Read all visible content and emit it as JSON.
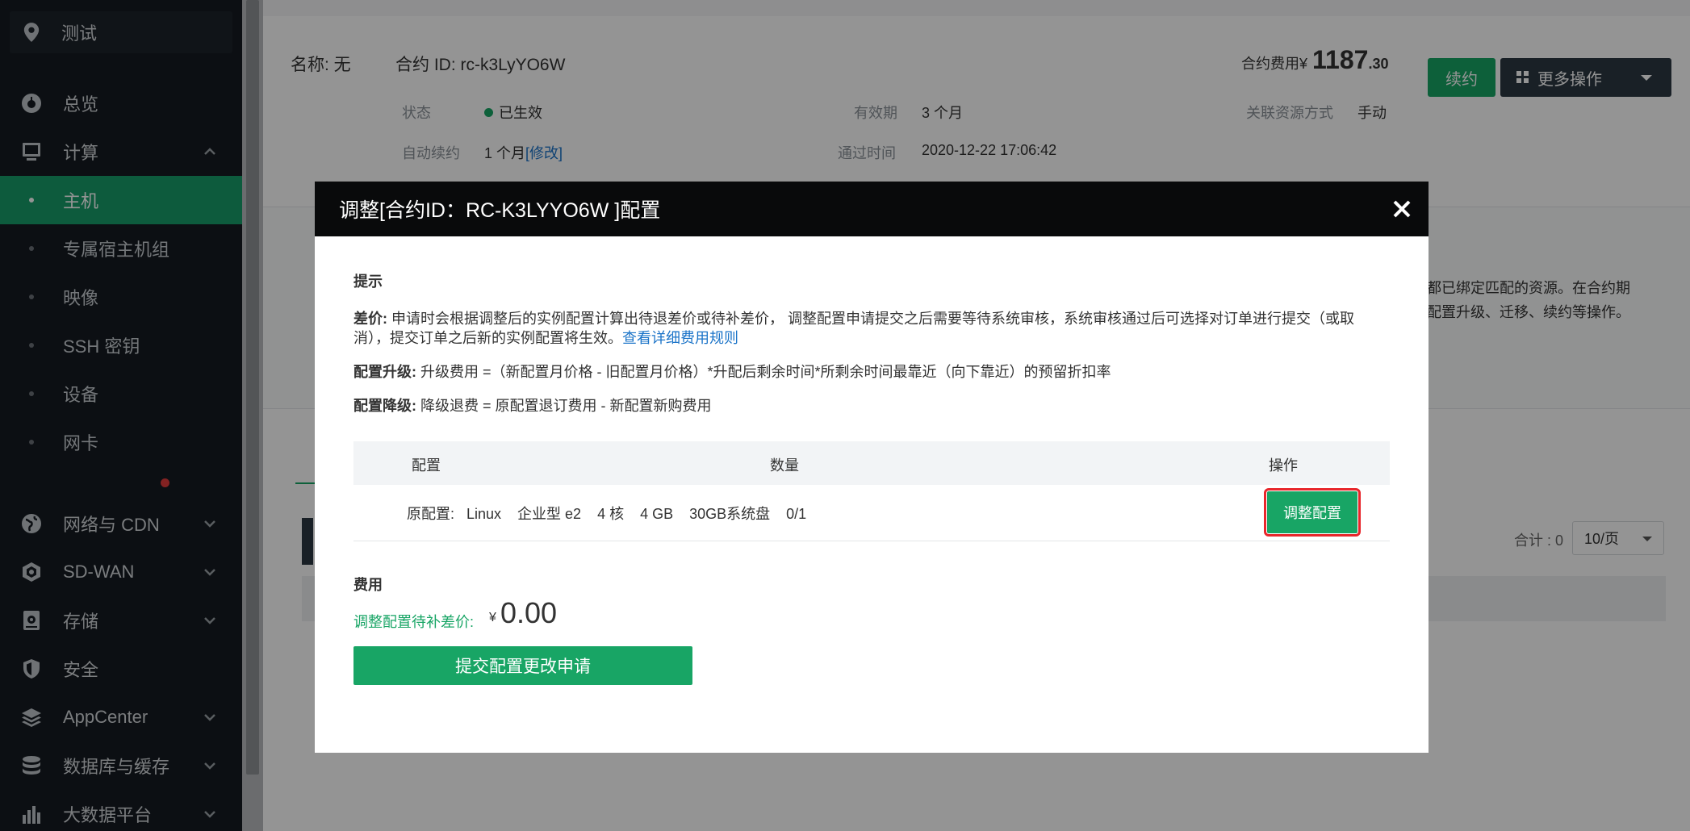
{
  "sidebar": {
    "project": "测试",
    "items": [
      {
        "label": "总览",
        "icon": "dashboard-icon"
      },
      {
        "label": "计算",
        "icon": "monitor-icon",
        "expanded": true
      },
      {
        "label": "网络与 CDN",
        "icon": "globe-icon",
        "badge": "red-dot"
      },
      {
        "label": "SD-WAN",
        "icon": "hexagon-icon"
      },
      {
        "label": "存储",
        "icon": "disk-icon"
      },
      {
        "label": "安全",
        "icon": "shield-icon"
      },
      {
        "label": "AppCenter",
        "icon": "layers-icon"
      },
      {
        "label": "数据库与缓存",
        "icon": "database-icon"
      },
      {
        "label": "大数据平台",
        "icon": "bar-chart-icon"
      }
    ],
    "sub_items": [
      "主机",
      "专属宿主机组",
      "映像",
      "SSH 密钥",
      "设备",
      "网卡"
    ],
    "active_sub": "主机"
  },
  "page": {
    "name_label": "名称: 无",
    "contract_id_label": "合约 ID: rc-k3LyYO6W",
    "fee_label": "合约费用",
    "fee_currency": "¥",
    "fee_int": "1187",
    "fee_dec": ".30",
    "renew_button": "续约",
    "more_button": "更多操作",
    "status_label": "状态",
    "status_value": "已生效",
    "validity_label": "有效期",
    "validity_value": "3 个月",
    "bind_label": "关联资源方式",
    "bind_value": "手动",
    "auto_renew_label": "自动续约",
    "auto_renew_value": "1 个月",
    "auto_renew_link": "[修改]",
    "pass_time_label": "通过时间",
    "pass_time_value": "2020-12-22 17:06:42",
    "side_text_1": "约都已绑定匹配的资源。在合约期",
    "side_text_2": "行配置升级、迁移、续约等操作。",
    "total_label": "合计 : 0",
    "page_size": "10/页"
  },
  "modal": {
    "title": "调整[合约ID：RC-K3LYYO6W ]配置",
    "tips_heading": "提示",
    "diff_label": "差价:",
    "diff_text_1": "申请时会根据调整后的实例配置计算出待退差价或待补差价， 调整配置申请提交之后需要等待系统审核，系统审核通过后可选择对订单进行提交（或取",
    "diff_text_2": "消），提交订单之后新的实例配置将生效。",
    "diff_link": "查看详细费用规则",
    "upgrade_label": "配置升级:",
    "upgrade_text": "升级费用 =（新配置月价格 - 旧配置月价格）*升配后剩余时间*所剩余时间最靠近（向下靠近）的预留折扣率",
    "downgrade_label": "配置降级:",
    "downgrade_text": "降级退费 = 原配置退订费用 - 新配置新购费用",
    "table": {
      "headers": [
        "配置",
        "数量",
        "操作"
      ],
      "row": {
        "config": "原配置:   Linux    企业型 e2    4 核    4 GB    30GB系统盘    0/1",
        "action": "调整配置"
      }
    },
    "fee_heading": "费用",
    "pending_label": "调整配置待补差价:",
    "pending_currency": "¥",
    "pending_value": "0.00",
    "submit_button": "提交配置更改申请"
  },
  "colors": {
    "accent": "#18a565",
    "sidebar_bg": "#151b21",
    "highlight": "#e8262b"
  }
}
